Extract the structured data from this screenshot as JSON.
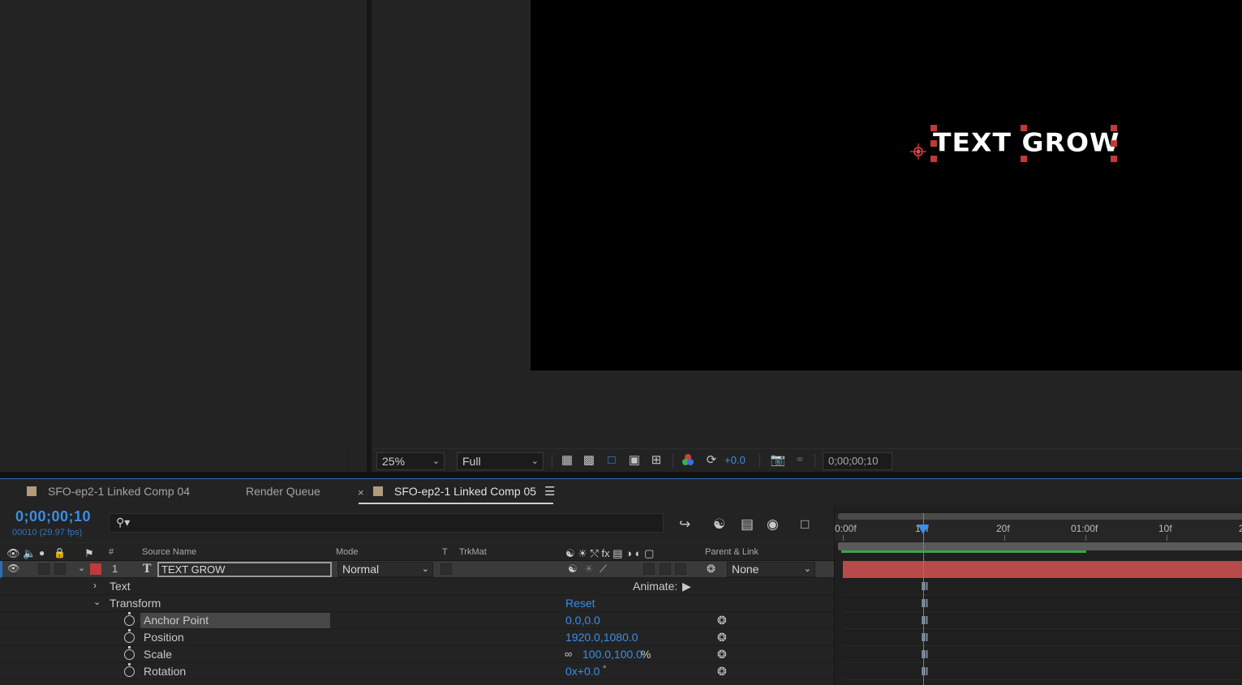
{
  "viewer": {
    "canvas_text": "TEXT GROW",
    "zoom": "25%",
    "resolution": "Full",
    "exposure": "+0.0",
    "timecode": "0;00;00;10"
  },
  "tabs": [
    {
      "label": "SFO-ep2-1 Linked Comp 04",
      "swatch": "#b19b7a"
    },
    {
      "label": "Render Queue"
    },
    {
      "label": "SFO-ep2-1 Linked Comp 05",
      "swatch": "#b19b7a",
      "active": true
    }
  ],
  "timeline": {
    "timecode": "0;00;00;10",
    "fps": "00010 (29.97 fps)",
    "columns": {
      "hash": "#",
      "source_name": "Source Name",
      "mode": "Mode",
      "t": "T",
      "trkmat": "TrkMat",
      "parent": "Parent & Link"
    },
    "layer": {
      "index": "1",
      "type_glyph": "T",
      "name": "TEXT GROW",
      "mode": "Normal",
      "parent": "None",
      "label_color": "#c0393b"
    },
    "props": {
      "text": "Text",
      "animate": "Animate:",
      "transform": "Transform",
      "reset": "Reset",
      "anchor_point": {
        "label": "Anchor Point",
        "value": "0.0,0.0"
      },
      "position": {
        "label": "Position",
        "value": "1920.0,1080.0"
      },
      "scale": {
        "label": "Scale",
        "value": "100.0,100.0",
        "unit": "%"
      },
      "rotation": {
        "label": "Rotation",
        "value": "0x+0.0",
        "unit": "°"
      }
    },
    "ruler": {
      "labels": [
        "0:00f",
        "10f",
        "20f",
        "01:00f",
        "10f",
        "2"
      ]
    }
  },
  "colors": {
    "accent": "#3a8ee6",
    "layer_bar": "#b84a4c",
    "work_area": "#36a845",
    "tab_swatch": "#b19b7a"
  }
}
